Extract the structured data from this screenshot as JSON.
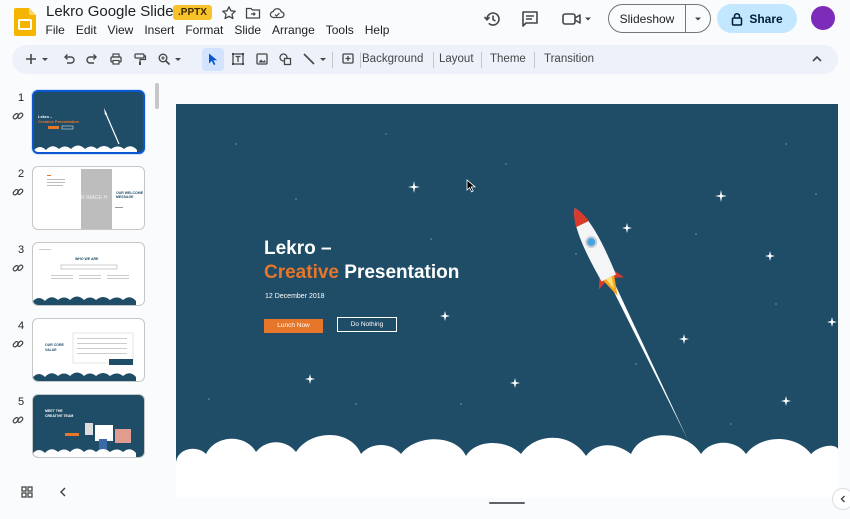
{
  "app": {
    "title": "Lekro Google Slides",
    "file_badge": ".PPTX",
    "icons": [
      "star-icon",
      "move-to-folder-icon",
      "cloud-status-icon"
    ]
  },
  "menu": [
    "File",
    "Edit",
    "View",
    "Insert",
    "Format",
    "Slide",
    "Arrange",
    "Tools",
    "Help"
  ],
  "header_actions": {
    "icons": [
      "history-icon",
      "comments-icon",
      "meet-video-icon"
    ],
    "slideshow_label": "Slideshow",
    "share_label": "Share"
  },
  "toolbar": {
    "icons": [
      "new-slide-icon",
      "undo-icon",
      "redo-icon",
      "print-icon",
      "paint-format-icon",
      "zoom-icon",
      "select-cursor-icon",
      "text-box-icon",
      "image-icon",
      "shapes-icon",
      "line-icon",
      "insert-comment-icon",
      "collapse-toolbar-icon"
    ],
    "background_label": "Background",
    "layout_label": "Layout",
    "theme_label": "Theme",
    "transition_label": "Transition"
  },
  "filmstrip": {
    "slides": [
      {
        "number": "1",
        "selected": true
      },
      {
        "number": "2",
        "selected": false
      },
      {
        "number": "3",
        "selected": false
      },
      {
        "number": "4",
        "selected": false
      },
      {
        "number": "5",
        "selected": false
      }
    ]
  },
  "slide": {
    "title_line1": "Lekro –",
    "title_accent": "Creative",
    "title_rest": " Presentation",
    "date": "12 December 2018",
    "primary_button": "Lunch Now",
    "secondary_button": "Do Nothing"
  },
  "thumbs": {
    "t1_line1": "Lekro –",
    "t1_line2": "Creative Presentation",
    "t2_image_label": "R IMAGE H",
    "t2_heading": "OUR WELCOME MESSAGE",
    "t3_heading": "WHO WE ARE",
    "t4_heading": "OUR CORE VALUE",
    "t5_heading": "MEET THE CREATIVE TEAM"
  },
  "colors": {
    "slide_background": "#1f4c66",
    "accent_orange": "#e5762a",
    "selection_blue": "#0b57d0",
    "share_button": "#c2e7ff",
    "badge_yellow": "#f8c22b",
    "avatar_purple": "#7c2cb8"
  }
}
